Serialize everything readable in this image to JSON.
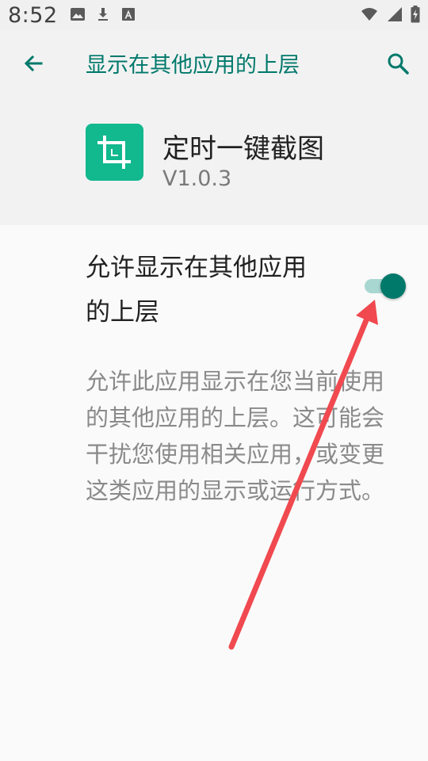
{
  "status_bar": {
    "time": "8:52",
    "left_icons": [
      "image-icon",
      "download-icon",
      "font-icon"
    ],
    "right_icons": [
      "wifi-icon",
      "signal-icon",
      "battery-icon"
    ]
  },
  "header": {
    "title": "显示在其他应用的上层",
    "back_icon": "back-arrow-icon",
    "search_icon": "search-icon"
  },
  "app": {
    "name": "定时一键截图",
    "version": "V1.0.3",
    "icon": "crop-icon",
    "icon_color": "#12b88e"
  },
  "setting": {
    "title": "允许显示在其他应用的上层",
    "enabled": true
  },
  "description": "允许此应用显示在您当前使用的其他应用的上层。这可能会干扰您使用相关应用，或变更这类应用的显示或运行方式。",
  "colors": {
    "accent": "#00796b",
    "annotation": "#f0494f"
  }
}
